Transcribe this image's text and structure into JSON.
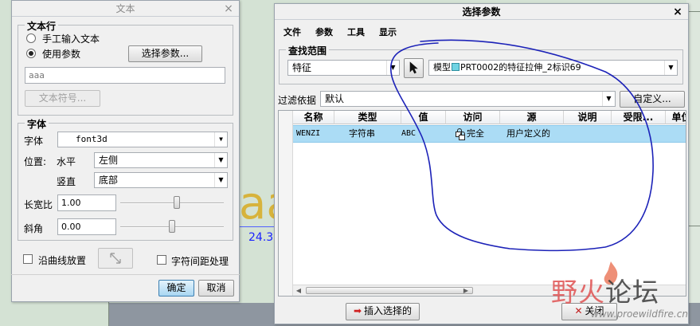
{
  "left_dialog": {
    "title": "文本",
    "text_line_group": {
      "title": "文本行",
      "radio_manual": "手工输入文本",
      "radio_param": "使用参数",
      "select_param_button": "选择参数...",
      "text_value": "aaa",
      "text_symbol_button": "文本符号..."
    },
    "font_group": {
      "title": "字体",
      "font_label": "字体",
      "font_value": "font3d",
      "position_label": "位置:",
      "horizontal_label": "水平",
      "horizontal_value": "左侧",
      "vertical_label": "竖直",
      "vertical_value": "底部",
      "aspect_label": "长宽比",
      "aspect_value": "1.00",
      "aspect_level": 0.55,
      "slant_label": "斜角",
      "slant_value": "0.00",
      "slant_level": 0.5
    },
    "along_curve_label": "沿曲线放置",
    "char_spacing_label": "字符间距处理",
    "ok_button": "确定",
    "cancel_button": "取消"
  },
  "right_dialog": {
    "title": "选择参数",
    "menu": [
      "文件",
      "参数",
      "工具",
      "显示"
    ],
    "search_scope_title": "查找范围",
    "scope_value": "特征",
    "model_label_prefix": "模型",
    "model_label_text": "PRT0002的特征拉伸_2标识69",
    "filter_label": "过滤依据",
    "filter_value": "默认",
    "customize_button": "自定义...",
    "columns": [
      "名称",
      "类型",
      "值",
      "访问",
      "源",
      "说明",
      "受限...",
      "单位"
    ],
    "rows": [
      {
        "name": "WENZI",
        "type": "字符串",
        "value": "ABC",
        "access": "完全",
        "source": "用户定义的",
        "desc": "",
        "restricted": "",
        "unit": ""
      }
    ],
    "insert_button": "插入选择的",
    "close_button": "关闭"
  },
  "canvas": {
    "dimension_text": "24.3",
    "letters": "aa"
  },
  "watermark": {
    "cn_red": "野火",
    "cn_dark": "论坛",
    "url": "www.proewildfire.cn"
  },
  "colors": {
    "selected_row": "#abdcf5",
    "annotation_stroke": "#1c22b8",
    "dimension": "#1a22ff",
    "cad_text": "#d7b33c"
  }
}
